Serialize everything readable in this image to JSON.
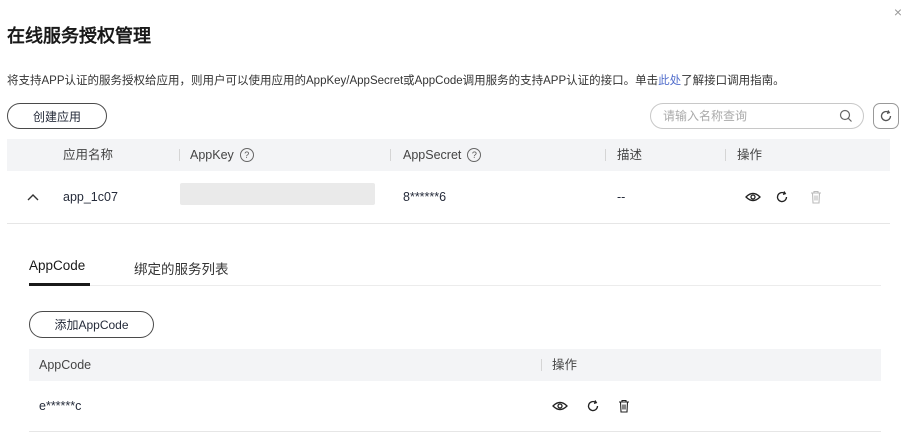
{
  "dialog": {
    "close_label": "×",
    "title": "在线服务授权管理",
    "description_prefix": "将支持APP认证的服务授权给应用，则用户可以使用应用的AppKey/AppSecret或AppCode调用服务的支持APP认证的接口。单击",
    "description_link": "此处",
    "description_suffix": "了解接口调用指南。"
  },
  "toolbar": {
    "create_label": "创建应用",
    "search_placeholder": "请输入名称查询"
  },
  "table": {
    "headers": {
      "name": "应用名称",
      "appkey": "AppKey",
      "appsecret": "AppSecret",
      "desc": "描述",
      "actions": "操作"
    },
    "rows": [
      {
        "name": "app_1c07",
        "appkey": "",
        "appsecret": "8******6",
        "desc": "--"
      }
    ]
  },
  "detail": {
    "tabs": [
      "AppCode",
      "绑定的服务列表"
    ],
    "active_tab": 0,
    "add_label": "添加AppCode",
    "headers": {
      "appcode": "AppCode",
      "actions": "操作"
    },
    "rows": [
      {
        "appcode": "e******c"
      }
    ]
  }
}
